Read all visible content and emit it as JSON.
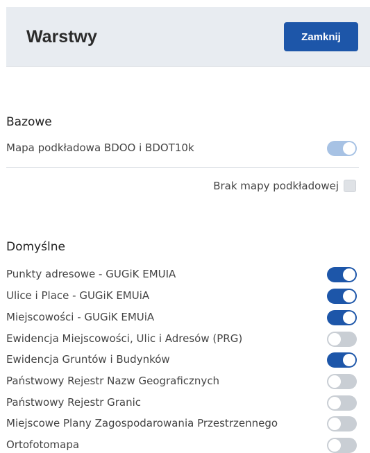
{
  "header": {
    "title": "Warstwy",
    "close_label": "Zamknij"
  },
  "bazowe": {
    "title": "Bazowe",
    "basemap_label": "Mapa podkładowa BDOO i BDOT10k",
    "basemap_on": true,
    "no_basemap_label": "Brak mapy podkładowej",
    "no_basemap_checked": false
  },
  "domyslne": {
    "title": "Domyślne",
    "layers": [
      {
        "label": "Punkty adresowe - GUGiK EMUIA",
        "on": true
      },
      {
        "label": "Ulice i Place - GUGiK EMUiA",
        "on": true
      },
      {
        "label": "Miejscowości - GUGiK EMUiA",
        "on": true
      },
      {
        "label": "Ewidencja Miejscowości, Ulic i Adresów (PRG)",
        "on": false
      },
      {
        "label": "Ewidencja Gruntów i Budynków",
        "on": true
      },
      {
        "label": "Państwowy Rejestr Nazw Geograficznych",
        "on": false
      },
      {
        "label": "Państwowy Rejestr Granic",
        "on": false
      },
      {
        "label": "Miejscowe Plany Zagospodarowania Przestrzennego",
        "on": false
      },
      {
        "label": "Ortofotomapa",
        "on": false
      }
    ]
  },
  "colors": {
    "accent": "#1d56a9",
    "toggle_off": "#c9ced4",
    "toggle_disabled_on": "#a7c2e4",
    "header_bg": "#e8ecf1"
  }
}
